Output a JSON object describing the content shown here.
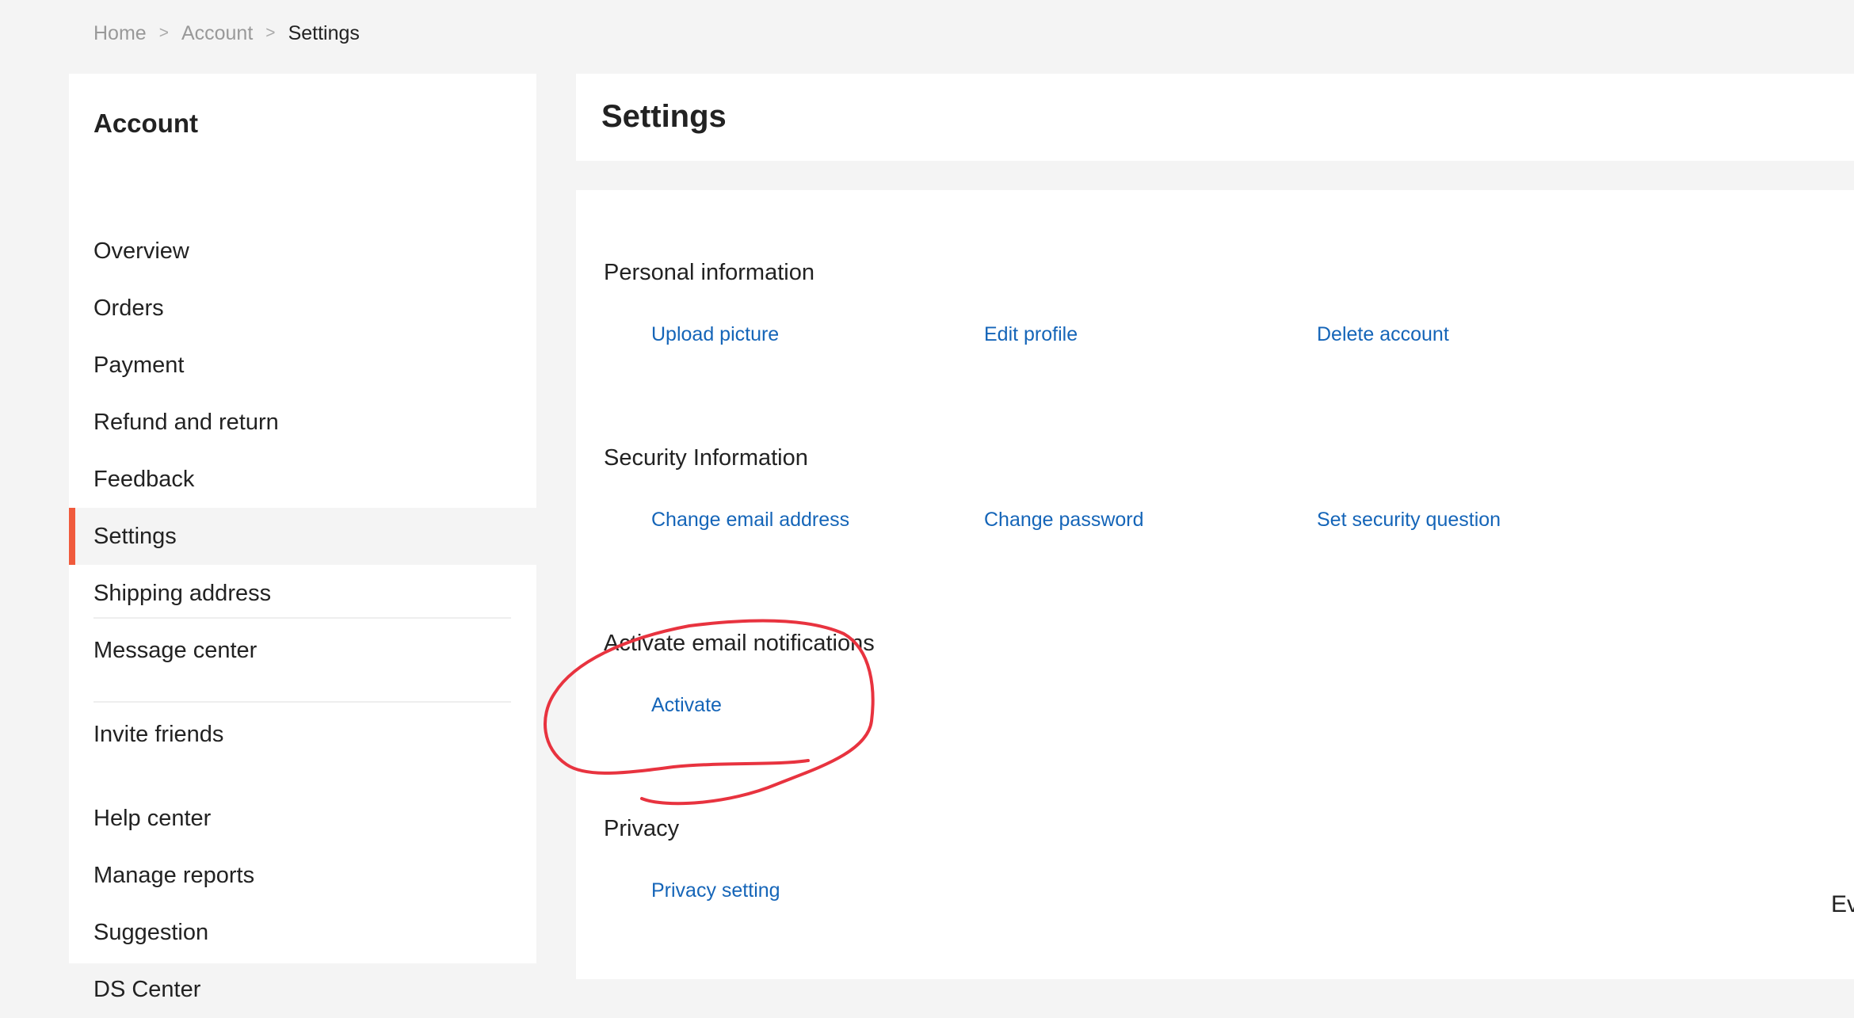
{
  "breadcrumb": {
    "items": [
      "Home",
      "Account",
      "Settings"
    ],
    "separator": ">"
  },
  "sidebar": {
    "title": "Account",
    "items": [
      {
        "label": "Overview"
      },
      {
        "label": "Orders"
      },
      {
        "label": "Payment"
      },
      {
        "label": "Refund and return"
      },
      {
        "label": "Feedback"
      },
      {
        "label": "Settings",
        "active": true
      },
      {
        "label": "Shipping address"
      },
      {
        "label": "Message center"
      },
      {
        "label": "Invite friends"
      },
      {
        "label": "Help center"
      },
      {
        "label": "Manage reports"
      },
      {
        "label": "Suggestion"
      },
      {
        "label": "DS Center"
      }
    ]
  },
  "header": {
    "title": "Settings"
  },
  "sections": {
    "personal": {
      "title": "Personal information",
      "links": [
        "Upload picture",
        "Edit profile",
        "Delete account"
      ]
    },
    "security": {
      "title": "Security Information",
      "links": [
        "Change email address",
        "Change password",
        "Set security question"
      ]
    },
    "notifications": {
      "title": "Activate email notifications",
      "links": [
        "Activate"
      ]
    },
    "privacy": {
      "title": "Privacy",
      "links": [
        "Privacy setting"
      ]
    }
  },
  "edge_text": "Ev",
  "colors": {
    "background": "#f4f4f4",
    "panel": "#ffffff",
    "link": "#1565b8",
    "active_indicator": "#f05a3c",
    "annotation": "#e8333f"
  }
}
